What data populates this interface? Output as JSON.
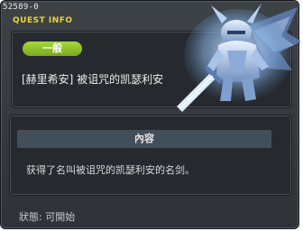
{
  "window": {
    "id_label": "52589-0",
    "title": "QUEST INFO"
  },
  "quest": {
    "category": "一般",
    "title": "[赫里希安] 被诅咒的凯瑟利安"
  },
  "content": {
    "header": "內容",
    "text": "获得了名叫被诅咒的凯瑟利安的名剑。"
  },
  "status": {
    "text": "狀態: 可開始"
  },
  "character": {
    "icon": "armored-knight-sword-icon"
  }
}
